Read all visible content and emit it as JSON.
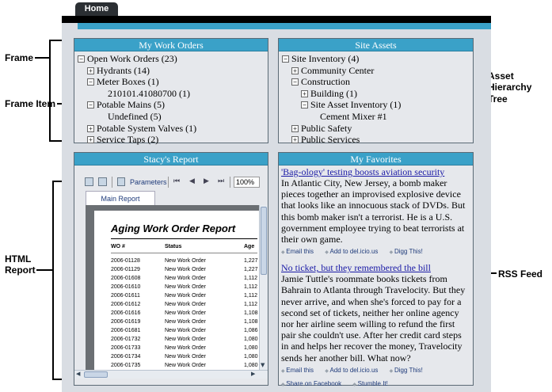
{
  "callouts": {
    "frame": "Frame",
    "frame_item": "Frame Item",
    "asset_tree": [
      "Asset",
      "Hierarchy",
      "Tree"
    ],
    "html_report": [
      "HTML",
      "Report"
    ],
    "rss_feed": "RSS Feed"
  },
  "tabs": {
    "home": "Home"
  },
  "work_orders": {
    "title": "My Work Orders",
    "items": [
      {
        "label": "Open Work Orders (23)",
        "toggle": "minus"
      },
      {
        "label": "Hydrants (14)",
        "toggle": "plus"
      },
      {
        "label": "Meter Boxes (1)",
        "toggle": "minus"
      },
      {
        "label": "210101.41080700 (1)",
        "toggle": ""
      },
      {
        "label": "Potable Mains (5)",
        "toggle": "minus"
      },
      {
        "label": "Undefined (5)",
        "toggle": ""
      },
      {
        "label": "Potable System Valves (1)",
        "toggle": "plus"
      },
      {
        "label": "Service Taps (2)",
        "toggle": "plus"
      }
    ]
  },
  "site_assets": {
    "title": "Site Assets",
    "items": [
      {
        "label": "Site Inventory (4)",
        "toggle": "minus"
      },
      {
        "label": "Community Center",
        "toggle": "plus"
      },
      {
        "label": "Construction",
        "toggle": "minus"
      },
      {
        "label": "Building (1)",
        "toggle": "plus"
      },
      {
        "label": "Site Asset Inventory (1)",
        "toggle": "minus"
      },
      {
        "label": "Cement Mixer #1",
        "toggle": ""
      },
      {
        "label": "Public Safety",
        "toggle": "plus"
      },
      {
        "label": "Public Services",
        "toggle": "plus"
      }
    ]
  },
  "report": {
    "title": "Stacy's Report",
    "toolbar": {
      "parameters": "Parameters",
      "zoom": "100%"
    },
    "tab": "Main Report",
    "heading": "Aging Work Order Report",
    "columns": [
      "WO #",
      "Status",
      "Age"
    ],
    "rows": [
      [
        "2006-01128",
        "New Work Order",
        "1,227"
      ],
      [
        "2006-01129",
        "New Work Order",
        "1,227"
      ],
      [
        "2006-01608",
        "New Work Order",
        "1,112"
      ],
      [
        "2006-01610",
        "New Work Order",
        "1,112"
      ],
      [
        "2006-01611",
        "New Work Order",
        "1,112"
      ],
      [
        "2006-01612",
        "New Work Order",
        "1,112"
      ],
      [
        "2006-01616",
        "New Work Order",
        "1,108"
      ],
      [
        "2006-01619",
        "New Work Order",
        "1,108"
      ],
      [
        "2006-01681",
        "New Work Order",
        "1,086"
      ],
      [
        "2006-01732",
        "New Work Order",
        "1,080"
      ],
      [
        "2006-01733",
        "New Work Order",
        "1,080"
      ],
      [
        "2006-01734",
        "New Work Order",
        "1,080"
      ],
      [
        "2006-01735",
        "New Work Order",
        "1,080"
      ]
    ]
  },
  "favorites": {
    "title": "My Favorites",
    "articles": [
      {
        "headline": "'Bag-ology' testing boosts aviation security",
        "body": "In Atlantic City, New Jersey, a bomb maker pieces together an improvised explosive device that looks like an innocuous stack of DVDs. But this bomb maker isn't a terrorist. He is a U.S. government employee trying to beat terrorists at their own game.",
        "actions": [
          "Email this",
          "Add to del.icio.us",
          "Digg This!"
        ]
      },
      {
        "headline": "No ticket, but they remembered the bill",
        "body": "Jamie Tuttle's roommate books tickets from Bahrain to Atlanta through Travelocity. But they never arrive, and when she's forced to pay for a second set of tickets, neither her online agency nor her airline seem willing to refund the first pair she couldn't use. After her credit card steps in and helps her recover the money, Travelocity sends her another bill. What now?",
        "actions": [
          "Email this",
          "Add to del.icio.us",
          "Digg This!",
          "Share on Facebook",
          "Stumble It!"
        ]
      }
    ]
  }
}
